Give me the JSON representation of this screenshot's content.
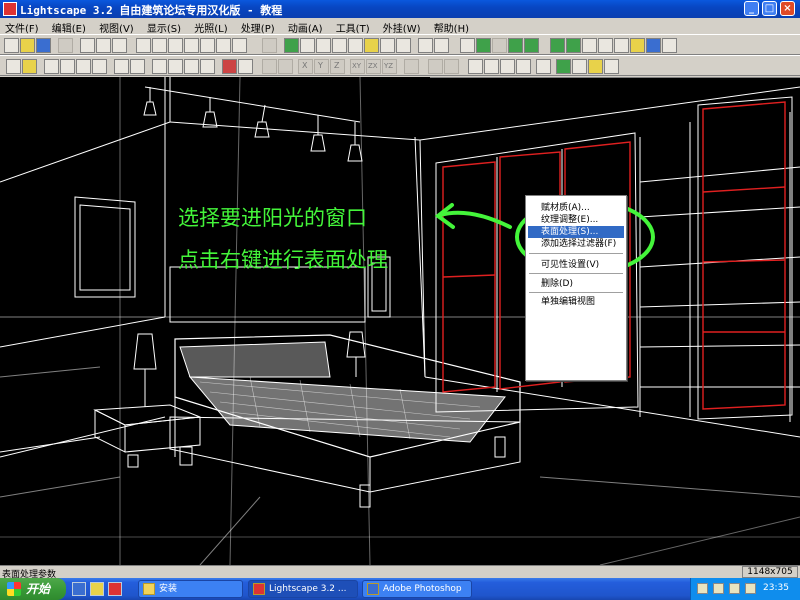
{
  "window": {
    "title": "Lightscape 3.2 自由建筑论坛专用汉化版  - 教程",
    "minimize": "_",
    "maximize": "□",
    "close": "×"
  },
  "menu": [
    "文件(F)",
    "编辑(E)",
    "视图(V)",
    "显示(S)",
    "光照(L)",
    "处理(P)",
    "动画(A)",
    "工具(T)",
    "外挂(W)",
    "帮助(H)"
  ],
  "toolbar2_labels": {
    "x": "X",
    "y": "Y",
    "z": "Z",
    "xy": "XY",
    "zx": "ZX",
    "yz": "YZ"
  },
  "annotations": {
    "line1": "选择要进阳光的窗口",
    "line2": "点击右键进行表面处理"
  },
  "annotation_color": "#44f53a",
  "window_highlight_color": "#e02020",
  "context_menu": {
    "items": [
      {
        "label": "赋材质(A)...",
        "selected": false
      },
      {
        "label": "纹理调整(E)...",
        "selected": false
      },
      {
        "label": "表面处理(S)...",
        "selected": true
      },
      {
        "label": "添加选择过滤器(F)",
        "selected": false
      },
      {
        "label": "可见性设置(V)",
        "selected": false
      },
      {
        "label": "删除(D)",
        "selected": false
      },
      {
        "label": "单独编辑视图",
        "selected": false
      }
    ]
  },
  "status": {
    "left": "表面处理参数",
    "right": "1148x705"
  },
  "taskbar": {
    "start": "开始",
    "tasks": [
      "安装",
      "Lightscape 3.2 ...",
      "Adobe Photoshop"
    ],
    "clock": "23:35"
  }
}
